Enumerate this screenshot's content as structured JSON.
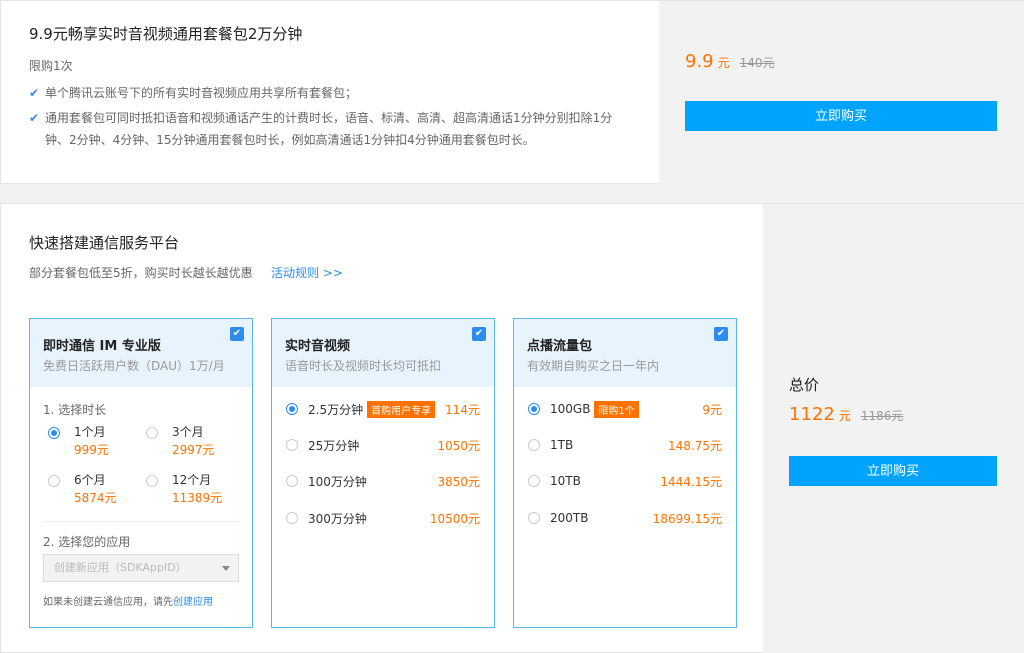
{
  "top": {
    "title": "9.9元畅享实时音视频通用套餐包2万分钟",
    "limit": "限购1次",
    "features": [
      "单个腾讯云账号下的所有实时音视频应用共享所有套餐包；",
      "通用套餐包可同时抵扣语音和视频通话产生的计费时长，语音、标清、高清、超高清通话1分钟分别扣除1分钟、2分钟、4分钟、15分钟通用套餐包时长，例如高清通话1分钟扣4分钟通用套餐包时长。"
    ],
    "price": "9.9",
    "price_unit": "元",
    "original_price": "140元",
    "buy_label": "立即购买"
  },
  "platform": {
    "title": "快速搭建通信服务平台",
    "subtitle": "部分套餐包低至5折，购买时长越长越优惠",
    "rules_link": "活动规则 >>",
    "im": {
      "name": "即时通信 IM 专业版",
      "desc": "免费日活跃用户数（DAU）1万/月",
      "step1": "1. 选择时长",
      "durations": [
        {
          "label": "1个月",
          "price": "999元",
          "selected": true
        },
        {
          "label": "3个月",
          "price": "2997元",
          "selected": false
        },
        {
          "label": "6个月",
          "price": "5874元",
          "selected": false
        },
        {
          "label": "12个月",
          "price": "11389元",
          "selected": false
        }
      ],
      "step2": "2. 选择您的应用",
      "select_placeholder": "创建新应用（SDKAppID）",
      "hint_prefix": "如果未创建云通信应用，请先",
      "hint_link": "创建应用"
    },
    "av": {
      "name": "实时音视频",
      "desc": "语音时长及视频时长均可抵扣",
      "options": [
        {
          "label": "2.5万分钟",
          "tag": "首购用户专享",
          "price": "114元",
          "selected": true
        },
        {
          "label": "25万分钟",
          "tag": "",
          "price": "1050元",
          "selected": false
        },
        {
          "label": "100万分钟",
          "tag": "",
          "price": "3850元",
          "selected": false
        },
        {
          "label": "300万分钟",
          "tag": "",
          "price": "10500元",
          "selected": false
        }
      ]
    },
    "cdn": {
      "name": "点播流量包",
      "desc": "有效期自购买之日一年内",
      "options": [
        {
          "label": "100GB",
          "tag": "限购1个",
          "price": "9元",
          "selected": true
        },
        {
          "label": "1TB",
          "tag": "",
          "price": "148.75元",
          "selected": false
        },
        {
          "label": "10TB",
          "tag": "",
          "price": "1444.15元",
          "selected": false
        },
        {
          "label": "200TB",
          "tag": "",
          "price": "18699.15元",
          "selected": false
        }
      ]
    },
    "total": {
      "label": "总价",
      "price": "1122",
      "unit": "元",
      "original": "1186元",
      "buy_label": "立即购买"
    }
  },
  "icons": {
    "check": "check-icon",
    "checkbox": "checkbox-checked-icon",
    "caret": "caret-down-icon"
  },
  "colors": {
    "accent": "#00a4ff",
    "price": "#ff7200",
    "link": "#2d8cf0"
  }
}
